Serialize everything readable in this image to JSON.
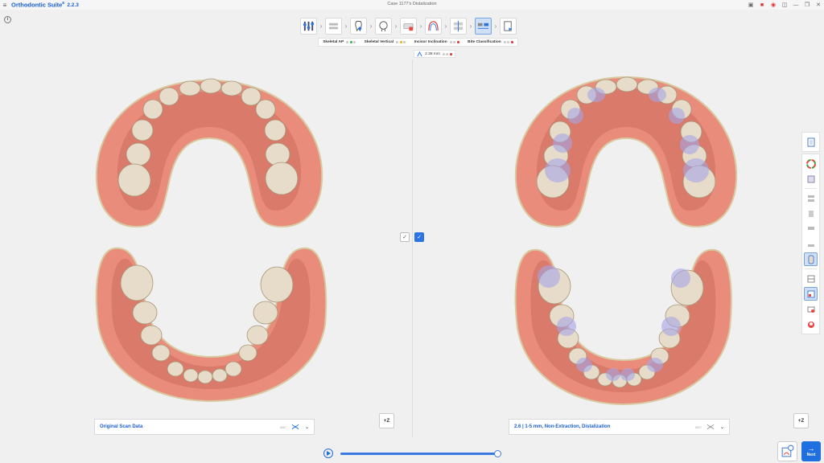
{
  "app": {
    "name": "Orthodontic Suite",
    "superscript": "E",
    "version": "2.2.3",
    "case_title": "Case 1177's Distalization"
  },
  "workflow": {
    "steps": [
      {
        "icon": "alignment-setup-icon",
        "active": false
      },
      {
        "icon": "dental-arch-icon",
        "active": false
      },
      {
        "icon": "tooth-segmentation-icon",
        "active": false
      },
      {
        "icon": "face-scan-icon",
        "active": false
      },
      {
        "icon": "model-base-icon",
        "active": false
      },
      {
        "icon": "arch-form-icon",
        "active": false
      },
      {
        "icon": "ipr-icon",
        "active": false
      },
      {
        "icon": "treatment-compare-icon",
        "active": true
      },
      {
        "icon": "report-export-icon",
        "active": false
      }
    ]
  },
  "classification": [
    {
      "label": "Skeletal AP",
      "dots": [
        "gray",
        "green",
        "gray"
      ]
    },
    {
      "label": "Skeletal Vertical",
      "dots": [
        "gray",
        "yellow",
        "gray"
      ]
    },
    {
      "label": "Incisor Inclination",
      "dots": [
        "gray",
        "gray",
        "red"
      ]
    },
    {
      "label": "Bite Classification",
      "dots": [
        "gray",
        "gray",
        "red"
      ]
    }
  ],
  "overjet": {
    "value": "2.38 mm",
    "dots": [
      "gray",
      "gray",
      "red"
    ]
  },
  "left_panel": {
    "label": "Original Scan Data",
    "tiny_text": "ABC"
  },
  "right_panel": {
    "label": "2.6  |  1-5 mm, Non-Extraction, Distalization",
    "tiny_text": "ABC"
  },
  "z_button": "+Z",
  "next_button": "Next",
  "timeline": {
    "progress": 1.0
  },
  "colors": {
    "accent": "#1f6fe0",
    "gum": "#e88f7f",
    "tooth": "#e6dcc9",
    "planned_overlay": "#a7a5e8"
  }
}
